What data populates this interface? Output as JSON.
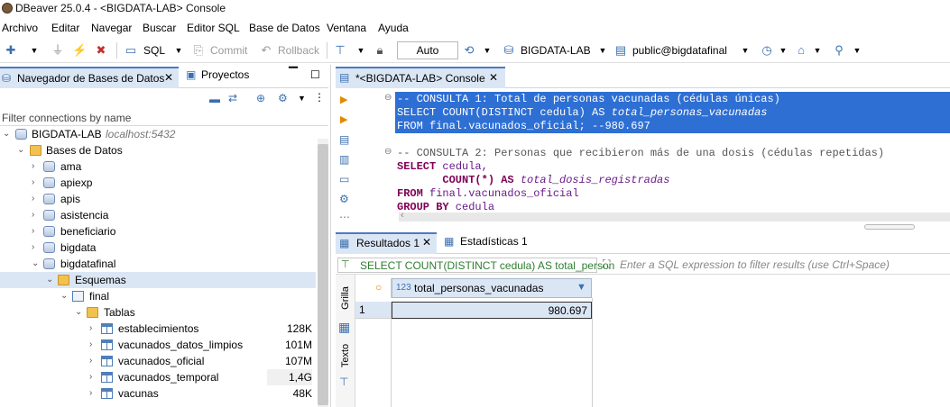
{
  "window": {
    "title": "DBeaver 25.0.4 - <BIGDATA-LAB> Console"
  },
  "menu": [
    "Archivo",
    "Editar",
    "Navegar",
    "Buscar",
    "Editor SQL",
    "Base de Datos",
    "Ventana",
    "Ayuda"
  ],
  "toolbar": {
    "sql_label": "SQL",
    "commit_label": "Commit",
    "rollback_label": "Rollback",
    "auto_label": "Auto",
    "connection_label": "BIGDATA-LAB",
    "schema_label": "public@bigdatafinal"
  },
  "left_panel": {
    "tab_navigator": "Navegador de Bases de Datos",
    "tab_projects": "Proyectos",
    "filter_placeholder": "Filter connections by name",
    "tree": {
      "connection": "BIGDATA-LAB",
      "connection_host": "localhost:5432",
      "databases_folder": "Bases de Datos",
      "databases": [
        "ama",
        "apiexp",
        "apis",
        "asistencia",
        "beneficiario",
        "bigdata",
        "bigdatafinal"
      ],
      "schemas_folder": "Esquemas",
      "schema": "final",
      "tables_folder": "Tablas",
      "tables": [
        {
          "name": "establecimientos",
          "size": "128K"
        },
        {
          "name": "vacunados_datos_limpios",
          "size": "101M"
        },
        {
          "name": "vacunados_oficial",
          "size": "107M"
        },
        {
          "name": "vacunados_temporal",
          "size": "1,4G"
        },
        {
          "name": "vacunas",
          "size": "48K"
        }
      ]
    }
  },
  "editor": {
    "tab_label": "*<BIGDATA-LAB> Console",
    "lines": {
      "l1": "-- CONSULTA 1: Total de personas vacunadas (cédulas únicas)",
      "l2a": "SELECT COUNT(DISTINCT cedula) AS ",
      "l2b": "total_personas_vacunadas",
      "l3": "FROM final.vacunados_oficial; --980.697",
      "l5": "-- CONSULTA 2: Personas que recibieron más de una dosis (cédulas repetidas)",
      "l6a": "SELECT",
      "l6b": " cedula,",
      "l7a": "       COUNT(*) ",
      "l7b": "AS",
      "l7c": " total_dosis_registradas",
      "l8a": "FROM",
      "l8b": " final.vacunados_oficial",
      "l9a": "GROUP BY",
      "l9b": " cedula"
    }
  },
  "results": {
    "tab_results": "Resultados 1",
    "tab_stats": "Estadísticas 1",
    "query_text": "SELECT COUNT(DISTINCT cedula) AS total_person",
    "filter_placeholder": "Enter a SQL expression to filter results (use Ctrl+Space)",
    "side_grid": "Grilla",
    "side_text": "Texto",
    "column_type": "123",
    "column_name": "total_personas_vacunadas",
    "rows": [
      {
        "num": "1",
        "value": "980.697"
      }
    ]
  },
  "colors": {
    "selection": "#2e6fd4",
    "tab_active": "#dbe6f5",
    "keyword": "#7f0055"
  }
}
